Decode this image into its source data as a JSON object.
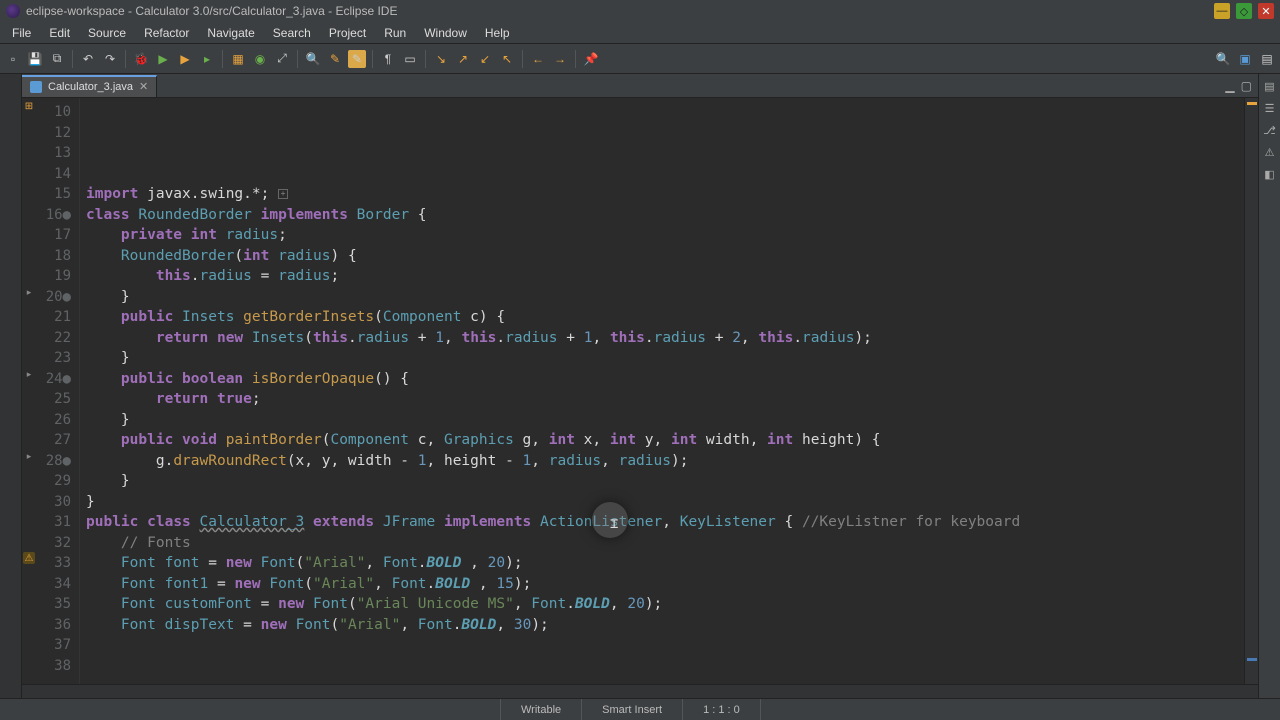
{
  "window": {
    "title": "eclipse-workspace - Calculator 3.0/src/Calculator_3.java - Eclipse IDE"
  },
  "menu": {
    "items": [
      "File",
      "Edit",
      "Source",
      "Refactor",
      "Navigate",
      "Search",
      "Project",
      "Run",
      "Window",
      "Help"
    ]
  },
  "tab": {
    "filename": "Calculator_3.java"
  },
  "code": {
    "lines": [
      {
        "n": "10",
        "t": "import_line"
      },
      {
        "n": "12",
        "t": "blank"
      },
      {
        "n": "13",
        "t": "class_decl"
      },
      {
        "n": "14",
        "t": "private_radius"
      },
      {
        "n": "15",
        "t": "blank"
      },
      {
        "n": "16",
        "t": "ctor"
      },
      {
        "n": "17",
        "t": "ctor_body"
      },
      {
        "n": "18",
        "t": "close"
      },
      {
        "n": "19",
        "t": "blank"
      },
      {
        "n": "20",
        "t": "getinsets"
      },
      {
        "n": "21",
        "t": "insets_return"
      },
      {
        "n": "22",
        "t": "close"
      },
      {
        "n": "23",
        "t": "blank"
      },
      {
        "n": "24",
        "t": "isopaque"
      },
      {
        "n": "25",
        "t": "return_true"
      },
      {
        "n": "26",
        "t": "close"
      },
      {
        "n": "27",
        "t": "blank"
      },
      {
        "n": "28",
        "t": "paintborder"
      },
      {
        "n": "29",
        "t": "drawround"
      },
      {
        "n": "30",
        "t": "close"
      },
      {
        "n": "31",
        "t": "class_close"
      },
      {
        "n": "32",
        "t": "blank"
      },
      {
        "n": "33",
        "t": "calc_class"
      },
      {
        "n": "34",
        "t": "fonts_cmt"
      },
      {
        "n": "35",
        "t": "font1"
      },
      {
        "n": "36",
        "t": "font2"
      },
      {
        "n": "37",
        "t": "font3"
      },
      {
        "n": "38",
        "t": "font4"
      }
    ],
    "text": {
      "import_kw": "import",
      "import_rest": " javax.swing.*;",
      "class_kw": "class",
      "rounded": "RoundedBorder",
      "implements_kw": "implements",
      "border": "Border",
      "private_kw": "private",
      "int_kw": "int",
      "radius_f": "radius",
      "ctor_name": "RoundedBorder",
      "this_kw": "this",
      "public_kw": "public",
      "insets_t": "Insets",
      "getinsets_m": "getBorderInsets",
      "component_t": "Component",
      "return_kw": "return",
      "new_kw": "new",
      "boolean_kw": "boolean",
      "isopaque_m": "isBorderOpaque",
      "true_kw": "true",
      "void_kw": "void",
      "paint_m": "paintBorder",
      "graphics_t": "Graphics",
      "extends_kw": "extends",
      "calc_name": "Calculator_3",
      "jframe_t": "JFrame",
      "al_t": "ActionListener",
      "kl_t": "KeyListener",
      "keycomment": "//KeyListner for keyboard",
      "fonts_comment": "// Fonts",
      "font_t": "Font",
      "bold_f": "BOLD",
      "arial": "\"Arial\"",
      "arial_uni": "\"Arial Unicode MS\"",
      "n1": "1",
      "n2": "2",
      "n20": "20",
      "n15": "15",
      "n30": "30"
    }
  },
  "status": {
    "writable": "Writable",
    "insert": "Smart Insert",
    "position": "1 : 1 : 0"
  }
}
